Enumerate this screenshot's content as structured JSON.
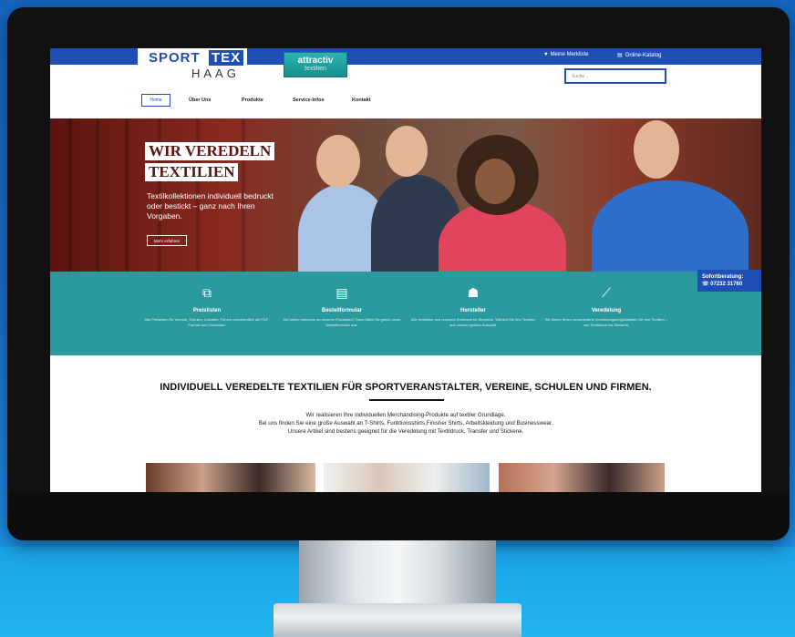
{
  "brand": {
    "sport": "SPORT",
    "tex": "TEX",
    "haag": "HAAG",
    "partner": "attractiv",
    "partner_sub": "textilien"
  },
  "topnav": {
    "merkliste": "Meine Merkliste",
    "katalog": "Online-Katalog"
  },
  "search": {
    "placeholder": "Suche..."
  },
  "mainnav": {
    "items": [
      "Home",
      "Über Uns",
      "Produkte",
      "Service-Infos",
      "Kontakt"
    ]
  },
  "hero": {
    "title_line1": "WIR VEREDELN",
    "title_line2": "TEXTILIEN",
    "subtitle": "Textilkollektionen individuell bedruckt oder bestickt – ganz nach Ihren Vorgaben.",
    "button": "Mehr erfahren"
  },
  "sofortberatung": {
    "label": "Sofortberatung:",
    "phone": "07232 31760"
  },
  "features": [
    {
      "icon": "price-tag-icon",
      "title": "Preislisten",
      "desc": "Alle Preislisten für Vereine, Schulen, Industrie, Firmen unverbindlich als PDF-Format zum Download."
    },
    {
      "icon": "form-icon",
      "title": "Bestellformular",
      "desc": "Sie haben Interesse an unseren Produkten? Dann füllen Sie gleich unser Bestellformular aus."
    },
    {
      "icon": "users-icon",
      "title": "Hersteller",
      "desc": "Alle Hersteller aus unserem Sortiment im Überblick. Wählen Sie Ihre Textilien aus unserer großen Auswahl."
    },
    {
      "icon": "wand-icon",
      "title": "Veredelung",
      "desc": "Wir bieten Ihnen verschiedene Veredelungsmöglichkeiten für Ihre Textilien – von Textildruck bis Stickerei."
    }
  ],
  "content": {
    "heading": "INDIVIDUELL VEREDELTE TEXTILIEN FÜR SPORTVERANSTALTER, VEREINE, SCHULEN UND FIRMEN.",
    "line1": "Wir realisieren Ihre individuellen Merchandising-Produkte auf textiler Grundlage.",
    "line2": "Bei uns finden Sie eine große Auswahl an T-Shirts, Funktionsshirts,Finisher Shirts, Arbeitskleidung und Businesswear.",
    "line3": "Unsere Artikel sind bestens geeignet für die Veredelung mit Textildruck, Transfer und Stickerei."
  },
  "colors": {
    "brand_blue": "#1f4fb5",
    "teal": "#2a9aa0",
    "hero_red": "#5a1410"
  }
}
